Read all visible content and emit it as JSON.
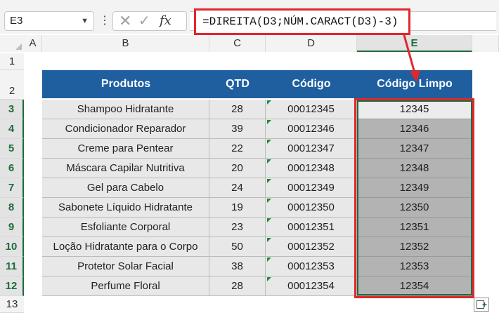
{
  "formula_bar": {
    "name_box": "E3",
    "cancel_symbol": "✕",
    "enter_symbol": "✓",
    "fx_label": "fx",
    "formula": "=DIREITA(D3;NÚM.CARACT(D3)-3)"
  },
  "columns": [
    "A",
    "B",
    "C",
    "D",
    "E"
  ],
  "rows": [
    "1",
    "2",
    "3",
    "4",
    "5",
    "6",
    "7",
    "8",
    "9",
    "10",
    "11",
    "12",
    "13"
  ],
  "selected_column": "E",
  "selected_rows": [
    "3",
    "4",
    "5",
    "6",
    "7",
    "8",
    "9",
    "10",
    "11",
    "12"
  ],
  "table": {
    "headers": [
      "Produtos",
      "QTD",
      "Código",
      "Código Limpo"
    ],
    "rows": [
      [
        "Shampoo Hidratante",
        "28",
        "00012345",
        "12345"
      ],
      [
        "Condicionador Reparador",
        "39",
        "00012346",
        "12346"
      ],
      [
        "Creme para Pentear",
        "22",
        "00012347",
        "12347"
      ],
      [
        "Máscara Capilar Nutritiva",
        "20",
        "00012348",
        "12348"
      ],
      [
        "Gel para Cabelo",
        "24",
        "00012349",
        "12349"
      ],
      [
        "Sabonete Líquido Hidratante",
        "19",
        "00012350",
        "12350"
      ],
      [
        "Esfoliante Corporal",
        "23",
        "00012351",
        "12351"
      ],
      [
        "Loção Hidratante para o Corpo",
        "50",
        "00012352",
        "12352"
      ],
      [
        "Protetor Solar Facial",
        "38",
        "00012353",
        "12353"
      ],
      [
        "Perfume Floral",
        "28",
        "00012354",
        "12354"
      ]
    ]
  },
  "colors": {
    "header_fill": "#1f5fa0",
    "highlight": "#e2262b",
    "selection": "#1e6b3c"
  }
}
